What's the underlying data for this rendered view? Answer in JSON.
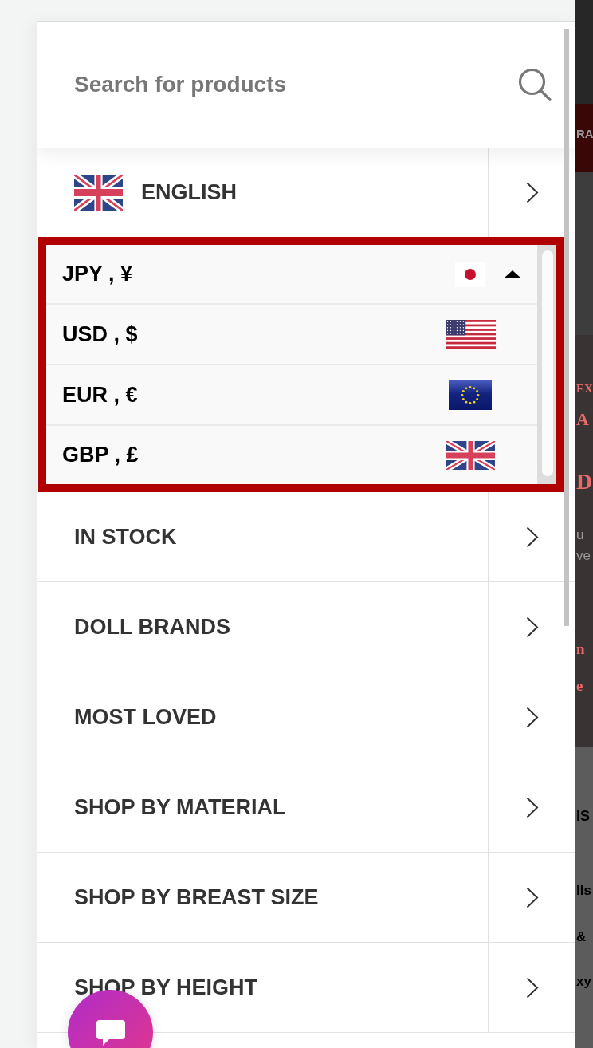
{
  "search": {
    "placeholder": "Search for products"
  },
  "language": {
    "label": "ENGLISH",
    "kind": "gb"
  },
  "currency_switcher": {
    "expanded": true,
    "current": {
      "label": "JPY , ¥",
      "kind": "jp"
    },
    "options": [
      {
        "label": "USD , $",
        "kind": "us"
      },
      {
        "label": "EUR , €",
        "kind": "eu"
      },
      {
        "label": "GBP , £",
        "kind": "gb"
      }
    ]
  },
  "menu": {
    "items": [
      {
        "label": "IN STOCK"
      },
      {
        "label": "DOLL BRANDS"
      },
      {
        "label": "MOST LOVED"
      },
      {
        "label": "SHOP BY MATERIAL"
      },
      {
        "label": "SHOP BY BREAST SIZE"
      },
      {
        "label": "SHOP BY HEIGHT"
      }
    ]
  },
  "background_page": {
    "fragments": [
      "RA",
      "EX",
      "A",
      "D",
      "u",
      "ve",
      "n",
      "e",
      "IS",
      "lls",
      "&",
      "xy"
    ]
  }
}
